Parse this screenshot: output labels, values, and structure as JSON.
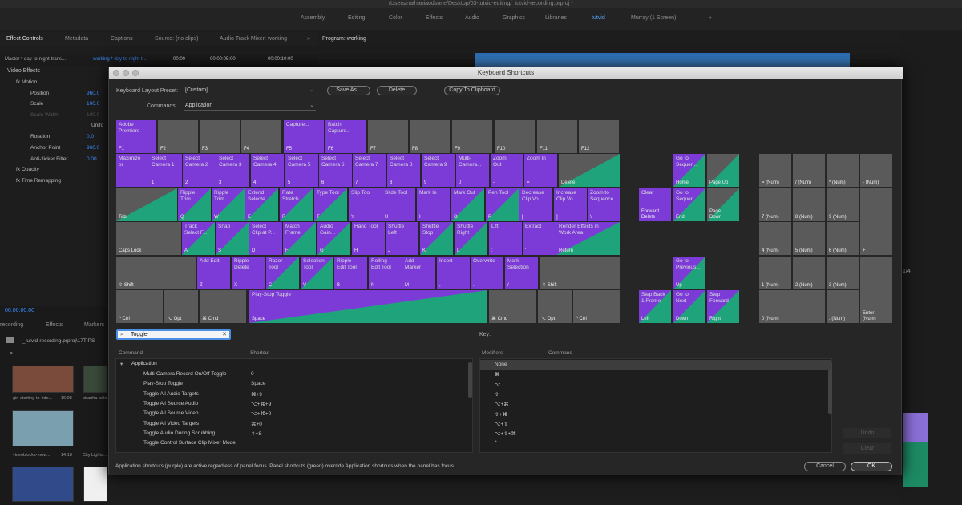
{
  "window": {
    "path": "/Users/nathaniaodsone/Desktop/03-tutvid-editing/_tutvid-recording.prproj *",
    "workspaces": [
      "Assembly",
      "Editing",
      "Color",
      "Effects",
      "Audio",
      "Graphics",
      "Libraries",
      "tutvid",
      "Murray (1 Screen)",
      "»"
    ]
  },
  "panels": {
    "tabs": [
      "Effect Controls",
      "Metadata",
      "Captions",
      "Source: (no clips)",
      "Audio Track Mixer: working",
      "»"
    ],
    "program_tab": "Program: working",
    "ec_master": "Master * day-to-night-trans...",
    "ec_sequence": "working * day-to-night-t...",
    "ec_time1": "00:00",
    "ec_time2": "00:00:05:00",
    "ec_time3": "00:00:10:00",
    "video_effects": "Video Effects",
    "effects": [
      {
        "label": "fx  Motion",
        "value": ""
      },
      {
        "label": "Position",
        "value": "960.0"
      },
      {
        "label": "Scale",
        "value": "100.0"
      },
      {
        "label": "Scale Width",
        "value": "100.0"
      },
      {
        "label": "Unifo",
        "value": ""
      },
      {
        "label": "Rotation",
        "value": "0.0"
      },
      {
        "label": "Anchor Point",
        "value": "960.0"
      },
      {
        "label": "Anti-flicker Filter",
        "value": "0.00"
      },
      {
        "label": "fx  Opacity",
        "value": ""
      },
      {
        "label": "fx  Time Remapping",
        "value": ""
      }
    ],
    "timecode": "00:00:00:00",
    "lower_tabs": [
      "recording",
      "Effects",
      "Markers"
    ],
    "project_name": "_tutvid-recording.prproj\\17TIPS",
    "thumbs": [
      {
        "label": "girl-starting-to-ride...",
        "duration": "16:08"
      },
      {
        "label": "piranha-colo...",
        "duration": ""
      },
      {
        "label": "videoblocks-mow...",
        "duration": "14:18"
      },
      {
        "label": "City Lights...",
        "duration": ""
      }
    ],
    "page_counter": "1/4"
  },
  "dialog": {
    "title": "Keyboard Shortcuts",
    "preset_label": "Keyboard Layout Preset:",
    "preset_value": "[Custom]",
    "commands_label": "Commands:",
    "commands_value": "Application",
    "save_as": "Save As...",
    "delete": "Delete",
    "copy_clipboard": "Copy To Clipboard",
    "search_value": "Toggle",
    "key_label": "Key:",
    "col_command": "Command",
    "col_shortcut": "Shortcut",
    "col_modifiers": "Modifiers",
    "col_command2": "Command",
    "application_group": "Application",
    "commands": [
      {
        "name": "Multi-Camera Record On/Off Toggle",
        "shortcut": "0"
      },
      {
        "name": "Play-Stop Toggle",
        "shortcut": "Space"
      },
      {
        "name": "Toggle All Audio Targets",
        "shortcut": "⌘+9"
      },
      {
        "name": "Toggle All Source Audio",
        "shortcut": "⌥+⌘+9"
      },
      {
        "name": "Toggle All Source Video",
        "shortcut": "⌥+⌘+0"
      },
      {
        "name": "Toggle All Video Targets",
        "shortcut": "⌘+0"
      },
      {
        "name": "Toggle Audio During Scrubbing",
        "shortcut": "⇧+S"
      },
      {
        "name": "Toggle Control Surface Clip Mixer Mode",
        "shortcut": ""
      }
    ],
    "modifiers": [
      "None",
      "⌘",
      "⌥",
      "⇧",
      "⌥+⌘",
      "⇧+⌘",
      "⌥+⇧",
      "⌥+⇧+⌘",
      "^"
    ],
    "undo": "Undo",
    "clear": "Clear",
    "footer": "Application shortcuts (purple) are active regardless of panel focus. Panel shortcuts (green) override Application shortcuts when the panel has focus.",
    "cancel": "Cancel",
    "ok": "OK"
  },
  "colors": {
    "application": "#7c3bd6",
    "panel": "#1fa37a",
    "unassigned": "#5a5a5a"
  },
  "keys": [
    {
      "label": "Adobe\nPremiere",
      "cap": "F1",
      "type": "p"
    },
    {
      "label": "",
      "cap": "F2",
      "type": "n"
    },
    {
      "label": "",
      "cap": "F3",
      "type": "n"
    },
    {
      "label": "",
      "cap": "F4",
      "type": "n"
    },
    {
      "label": "Capture...",
      "cap": "F5",
      "type": "p"
    },
    {
      "label": "Batch\nCapture...",
      "cap": "F6",
      "type": "p"
    },
    {
      "label": "",
      "cap": "F7",
      "type": "n"
    },
    {
      "label": "",
      "cap": "F8",
      "type": "n"
    },
    {
      "label": "",
      "cap": "F9",
      "type": "n"
    },
    {
      "label": "",
      "cap": "F10",
      "type": "n"
    },
    {
      "label": "",
      "cap": "F11",
      "type": "n"
    },
    {
      "label": "",
      "cap": "F12",
      "type": "n"
    },
    {
      "label": "Maximize\nor",
      "cap": "`",
      "type": "p"
    },
    {
      "label": "Select\nCamera 1",
      "cap": "1",
      "type": "p"
    },
    {
      "label": "Select\nCamera 2",
      "cap": "2",
      "type": "p"
    },
    {
      "label": "Select\nCamera 3",
      "cap": "3",
      "type": "p"
    },
    {
      "label": "Select\nCamera 4",
      "cap": "4",
      "type": "p"
    },
    {
      "label": "Select\nCamera 5",
      "cap": "5",
      "type": "p"
    },
    {
      "label": "Select\nCamera 6",
      "cap": "6",
      "type": "p"
    },
    {
      "label": "Select\nCamera 7",
      "cap": "7",
      "type": "p"
    },
    {
      "label": "Select\nCamera 8",
      "cap": "8",
      "type": "p"
    },
    {
      "label": "Select\nCamera 9",
      "cap": "9",
      "type": "p"
    },
    {
      "label": "Multi-\nCamera...",
      "cap": "0",
      "type": "p"
    },
    {
      "label": "Zoom\nOut",
      "cap": "-",
      "type": "p"
    },
    {
      "label": "Zoom In",
      "cap": "=",
      "type": "p"
    },
    {
      "label": "",
      "cap": "Delete",
      "type": "gg"
    },
    {
      "label": "",
      "cap": "Tab",
      "type": "gg"
    },
    {
      "label": "Ripple\nTrim",
      "cap": "Q",
      "type": "pg"
    },
    {
      "label": "Ripple\nTrim",
      "cap": "W",
      "type": "pg"
    },
    {
      "label": "Extend\nSelecte...",
      "cap": "E",
      "type": "pg"
    },
    {
      "label": "Rate\nStretch...",
      "cap": "R",
      "type": "pg"
    },
    {
      "label": "Type Tool",
      "cap": "T",
      "type": "pg"
    },
    {
      "label": "Slip Tool",
      "cap": "Y",
      "type": "p"
    },
    {
      "label": "Slide Tool",
      "cap": "U",
      "type": "p"
    },
    {
      "label": "Mark In",
      "cap": "I",
      "type": "p"
    },
    {
      "label": "Mark Out",
      "cap": "O",
      "type": "pg"
    },
    {
      "label": "Pen Tool",
      "cap": "P",
      "type": "pg"
    },
    {
      "label": "Decrease\nClip Vo...",
      "cap": "[",
      "type": "p"
    },
    {
      "label": "Increase\nClip Vo...",
      "cap": "]",
      "type": "p"
    },
    {
      "label": "Zoom to\nSequence",
      "cap": "\\",
      "type": "p"
    },
    {
      "label": "",
      "cap": "Caps Lock",
      "type": "n"
    },
    {
      "label": "Track\nSelect F...",
      "cap": "A",
      "type": "pg"
    },
    {
      "label": "Snap",
      "cap": "S",
      "type": "pg"
    },
    {
      "label": "Select\nClip at P...",
      "cap": "D",
      "type": "p"
    },
    {
      "label": "Match\nFrame",
      "cap": "F",
      "type": "pg"
    },
    {
      "label": "Audio\nGain...",
      "cap": "G",
      "type": "pg"
    },
    {
      "label": "Hand Tool",
      "cap": "H",
      "type": "p"
    },
    {
      "label": "Shuttle\nLeft",
      "cap": "J",
      "type": "p"
    },
    {
      "label": "Shuttle\nStop",
      "cap": "K",
      "type": "pg"
    },
    {
      "label": "Shuttle\nRight",
      "cap": "L",
      "type": "pg"
    },
    {
      "label": "Lift",
      "cap": ";",
      "type": "p"
    },
    {
      "label": "Extract",
      "cap": "'",
      "type": "p"
    },
    {
      "label": "Render Effects in\nWork Area",
      "cap": "Return",
      "type": "pg"
    },
    {
      "label": "",
      "cap": "⇧ Shift",
      "type": "n"
    },
    {
      "label": "Add Edit",
      "cap": "Z",
      "type": "p"
    },
    {
      "label": "Ripple\nDelete",
      "cap": "X",
      "type": "p"
    },
    {
      "label": "Razor\nTool",
      "cap": "C",
      "type": "pg"
    },
    {
      "label": "Selection\nTool",
      "cap": "V",
      "type": "pg"
    },
    {
      "label": "Ripple\nEdit Tool",
      "cap": "B",
      "type": "p"
    },
    {
      "label": "Rolling\nEdit Tool",
      "cap": "N",
      "type": "p"
    },
    {
      "label": "Add\nMarker",
      "cap": "M",
      "type": "p"
    },
    {
      "label": "Insert",
      "cap": ",",
      "type": "p"
    },
    {
      "label": "Overwrite",
      "cap": ".",
      "type": "p"
    },
    {
      "label": "Mark\nSelection",
      "cap": "/",
      "type": "p"
    },
    {
      "label": "",
      "cap": "⇧ Shift",
      "type": "n"
    },
    {
      "label": "",
      "cap": "^ Ctrl",
      "type": "n"
    },
    {
      "label": "",
      "cap": "⌥ Opt",
      "type": "n"
    },
    {
      "label": "",
      "cap": "⌘ Cmd",
      "type": "n"
    },
    {
      "label": "Play-Stop Toggle",
      "cap": "Space",
      "type": "pg"
    },
    {
      "label": "",
      "cap": "⌘ Cmd",
      "type": "n"
    },
    {
      "label": "",
      "cap": "⌥ Opt",
      "type": "n"
    },
    {
      "label": "",
      "cap": "^ Ctrl",
      "type": "n"
    },
    {
      "label": "Clear",
      "cap": "Forward\nDelete",
      "type": "p"
    },
    {
      "label": "Go to\nSequen...",
      "cap": "Home",
      "type": "pg"
    },
    {
      "label": "",
      "cap": "Page Up",
      "type": "gg"
    },
    {
      "label": "Go to\nSequen...",
      "cap": "End",
      "type": "pg"
    },
    {
      "label": "",
      "cap": "Page\nDown",
      "type": "gg"
    },
    {
      "label": "Go to\nPrevious...",
      "cap": "Up",
      "type": "pg"
    },
    {
      "label": "Step Back\n1 Frame",
      "cap": "Left",
      "type": "pg"
    },
    {
      "label": "Go to\nNext",
      "cap": "Down",
      "type": "pg"
    },
    {
      "label": "Step\nForward",
      "cap": "Right",
      "type": "pg"
    },
    {
      "label": "",
      "cap": "= (Num)",
      "type": "n"
    },
    {
      "label": "",
      "cap": "/ (Num)",
      "type": "n"
    },
    {
      "label": "",
      "cap": "* (Num)",
      "type": "n"
    },
    {
      "label": "",
      "cap": "- (Num)",
      "type": "n"
    },
    {
      "label": "",
      "cap": "7 (Num)",
      "type": "n"
    },
    {
      "label": "",
      "cap": "8 (Num)",
      "type": "n"
    },
    {
      "label": "",
      "cap": "9 (Num)",
      "type": "n"
    },
    {
      "label": "",
      "cap": "+",
      "type": "n"
    },
    {
      "label": "",
      "cap": "4 (Num)",
      "type": "n"
    },
    {
      "label": "",
      "cap": "5 (Num)",
      "type": "n"
    },
    {
      "label": "",
      "cap": "6 (Num)",
      "type": "n"
    },
    {
      "label": "",
      "cap": "1 (Num)",
      "type": "n"
    },
    {
      "label": "",
      "cap": "2 (Num)",
      "type": "n"
    },
    {
      "label": "",
      "cap": "3 (Num)",
      "type": "n"
    },
    {
      "label": "",
      "cap": "Enter\n(Num)",
      "type": "n"
    },
    {
      "label": "",
      "cap": "0 (Num)",
      "type": "n"
    },
    {
      "label": "",
      "cap": ". (Num)",
      "type": "n"
    }
  ]
}
